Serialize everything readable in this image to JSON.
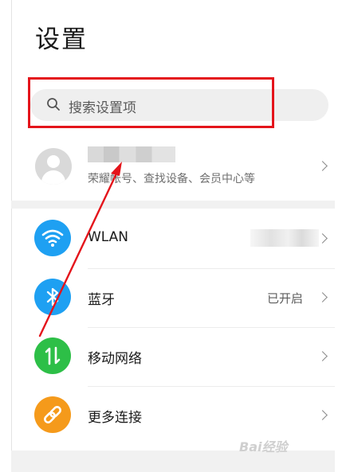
{
  "header": {
    "title": "设置"
  },
  "search": {
    "placeholder": "搜索设置项",
    "icon": "search-icon"
  },
  "account": {
    "description": "荣耀帐号、查找设备、会员中心等",
    "icon": "avatar-icon"
  },
  "items": [
    {
      "label": "WLAN",
      "value": "",
      "icon": "wifi-icon",
      "color": "#1ea0f2"
    },
    {
      "label": "蓝牙",
      "value": "已开启",
      "icon": "bluetooth-icon",
      "color": "#1ea0f2"
    },
    {
      "label": "移动网络",
      "value": "",
      "icon": "mobile-data-icon",
      "color": "#2dbf47"
    },
    {
      "label": "更多连接",
      "value": "",
      "icon": "link-icon",
      "color": "#f59a1b"
    }
  ],
  "colors": {
    "highlight": "#e4141b",
    "arrow": "#e4141b"
  },
  "watermark": {
    "text": "Bai经验"
  }
}
